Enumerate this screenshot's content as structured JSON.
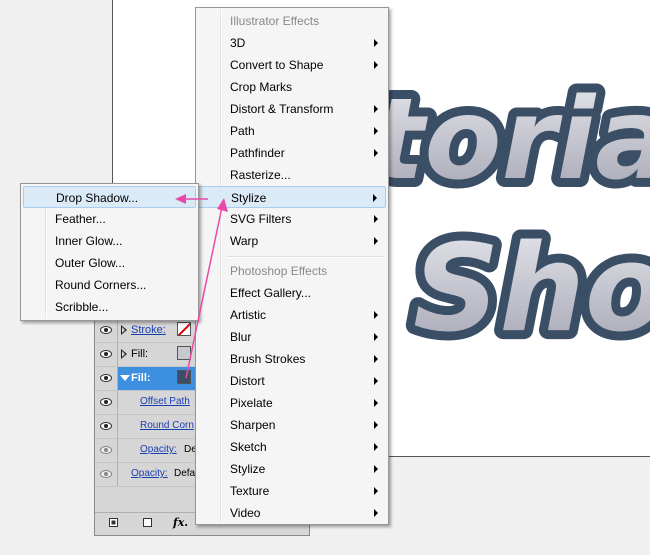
{
  "artwork": {
    "line1": "torial",
    "line2": "Shoo"
  },
  "effect_menu": {
    "illustrator_header": "Illustrator Effects",
    "illustrator_items": [
      {
        "label": "3D",
        "submenu": true
      },
      {
        "label": "Convert to Shape",
        "submenu": true
      },
      {
        "label": "Crop Marks",
        "submenu": false
      },
      {
        "label": "Distort & Transform",
        "submenu": true
      },
      {
        "label": "Path",
        "submenu": true
      },
      {
        "label": "Pathfinder",
        "submenu": true
      },
      {
        "label": "Rasterize...",
        "submenu": false
      },
      {
        "label": "Stylize",
        "submenu": true,
        "highlighted": true
      },
      {
        "label": "SVG Filters",
        "submenu": true
      },
      {
        "label": "Warp",
        "submenu": true
      }
    ],
    "photoshop_header": "Photoshop Effects",
    "photoshop_items": [
      {
        "label": "Effect Gallery...",
        "submenu": false
      },
      {
        "label": "Artistic",
        "submenu": true
      },
      {
        "label": "Blur",
        "submenu": true
      },
      {
        "label": "Brush Strokes",
        "submenu": true
      },
      {
        "label": "Distort",
        "submenu": true
      },
      {
        "label": "Pixelate",
        "submenu": true
      },
      {
        "label": "Sharpen",
        "submenu": true
      },
      {
        "label": "Sketch",
        "submenu": true
      },
      {
        "label": "Stylize",
        "submenu": true
      },
      {
        "label": "Texture",
        "submenu": true
      },
      {
        "label": "Video",
        "submenu": true
      }
    ]
  },
  "stylize_submenu": {
    "items": [
      {
        "label": "Drop Shadow...",
        "highlighted": true
      },
      {
        "label": "Feather..."
      },
      {
        "label": "Inner Glow..."
      },
      {
        "label": "Outer Glow..."
      },
      {
        "label": "Round Corners..."
      },
      {
        "label": "Scribble..."
      }
    ]
  },
  "appearance_panel": {
    "stroke_label": "Stroke:",
    "fill_label_1": "Fill:",
    "fill_label_2": "Fill:",
    "offset_path": "Offset Path",
    "round_corners": "Round Corn",
    "opacity_label": "Opacity:",
    "opacity_value": "De",
    "bottom_opacity_label": "Opacity:",
    "bottom_opacity_value": "Defa",
    "fx_label": "fx."
  },
  "colors": {
    "artwork_outline": "#3a4e66",
    "artwork_fill": "#c4c4d0",
    "annotation_arrow": "#e94aa8",
    "menu_highlight": "#dbeaf7",
    "panel_selected": "#3d8fe0"
  }
}
